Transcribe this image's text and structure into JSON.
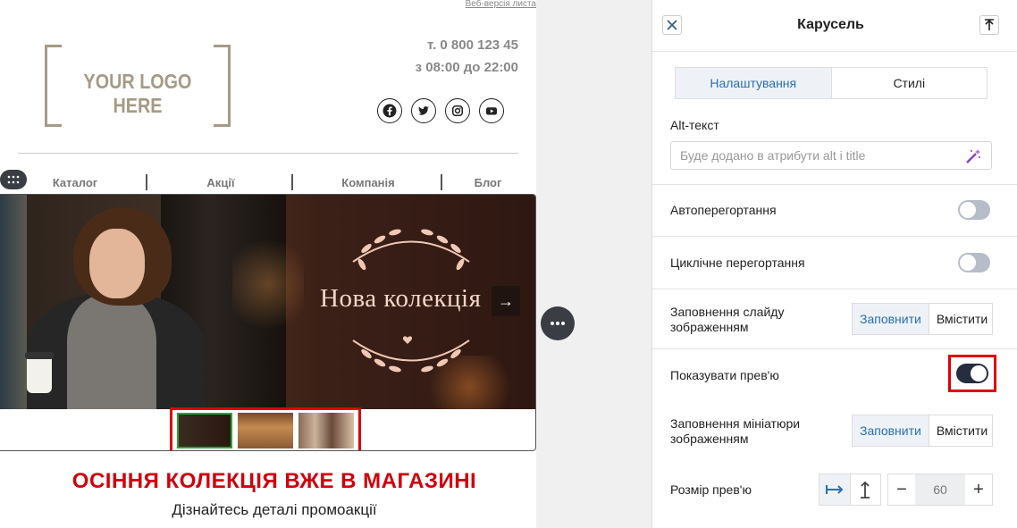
{
  "email": {
    "web_version_link": "Веб-версія листа",
    "logo_text": "YOUR LOGO HERE",
    "phone": "т. 0 800 123 45",
    "hours": "з 08:00 до 22:00",
    "socials": [
      "facebook-icon",
      "twitter-icon",
      "instagram-icon",
      "youtube-icon"
    ],
    "nav": [
      "Каталог",
      "Акції",
      "Компанія",
      "Блог"
    ],
    "slide_title": "Нова колекція",
    "thumbnails": [
      "thumb-1",
      "thumb-2",
      "thumb-3"
    ],
    "active_thumbnail": 0,
    "promo_title": "ОСІННЯ КОЛЕКЦІЯ ВЖЕ В МАГАЗИНІ",
    "promo_subtitle": "Дізнайтесь деталі промоакції"
  },
  "panel": {
    "title": "Карусель",
    "tabs": [
      "Налаштування",
      "Стилі"
    ],
    "active_tab": 0,
    "alt_text_label": "Alt-текст",
    "alt_text_placeholder": "Буде додано в атрибути alt і title",
    "autoplay_label": "Автоперегортання",
    "autoplay_on": false,
    "loop_label": "Циклічне перегортання",
    "loop_on": false,
    "slide_fill_label": "Заповнення слайду зображенням",
    "fill_options": [
      "Заповнити",
      "Вмістити"
    ],
    "slide_fill_selected": "Заповнити",
    "show_preview_label": "Показувати прев'ю",
    "show_preview_on": true,
    "thumb_fill_label": "Заповнення мініатюри зображенням",
    "thumb_fill_selected": "Заповнити",
    "preview_size_label": "Розмір прев'ю",
    "preview_size_value": "60",
    "accent_color": "#2a6fb4",
    "highlight_color": "#e00000"
  }
}
